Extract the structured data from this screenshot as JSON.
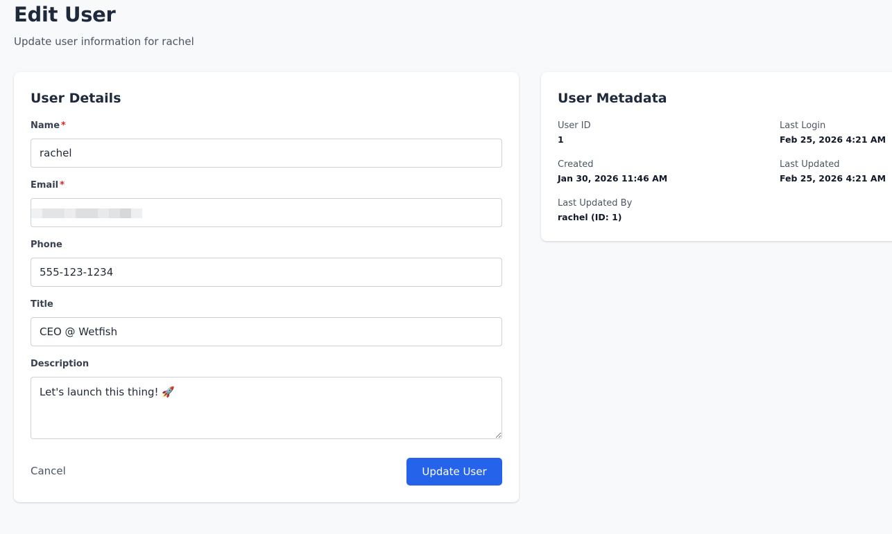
{
  "header": {
    "title": "Edit User",
    "subtitle": "Update user information for rachel"
  },
  "details": {
    "title": "User Details",
    "required_marker": "*",
    "name": {
      "label": "Name",
      "value": "rachel"
    },
    "email": {
      "label": "Email",
      "value": ""
    },
    "phone": {
      "label": "Phone",
      "value": "555-123-1234"
    },
    "title_field": {
      "label": "Title",
      "value": "CEO @ Wetfish"
    },
    "description": {
      "label": "Description",
      "value": "Let's launch this thing! 🚀"
    },
    "cancel_label": "Cancel",
    "submit_label": "Update User"
  },
  "metadata": {
    "title": "User Metadata",
    "user_id": {
      "label": "User ID",
      "value": "1"
    },
    "last_login": {
      "label": "Last Login",
      "value": "Feb 25, 2026 4:21 AM"
    },
    "created": {
      "label": "Created",
      "value": "Jan 30, 2026 11:46 AM"
    },
    "last_updated": {
      "label": "Last Updated",
      "value": "Feb 25, 2026 4:21 AM"
    },
    "last_updated_by": {
      "label": "Last Updated By",
      "value": "rachel (ID: 1)"
    }
  },
  "colors": {
    "accent": "#2563eb",
    "required": "#dc2626",
    "background": "#f8f9fb"
  }
}
